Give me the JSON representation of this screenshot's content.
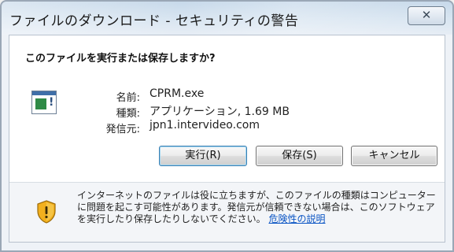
{
  "window": {
    "title": "ファイルのダウンロード - セキュリティの警告",
    "close_glyph": "✕"
  },
  "dialog": {
    "question": "このファイルを実行または保存しますか?",
    "file_icon": "executable-file-icon",
    "fields": {
      "name_label": "名前:",
      "name_value": "CPRM.exe",
      "type_label": "種類:",
      "type_value": "アプリケーション, 1.69 MB",
      "from_label": "発信元:",
      "from_value": "jpn1.intervideo.com"
    },
    "buttons": {
      "run": "実行(R)",
      "save": "保存(S)",
      "cancel": "キャンセル"
    },
    "warning": {
      "icon": "shield-warning-icon",
      "text": "インターネットのファイルは役に立ちますが、このファイルの種類はコンピューターに問題を起こす可能性があります。発信元が信頼できない場合は、このソフトウェアを実行したり保存したりしないでください。",
      "link": "危険性の説明"
    }
  }
}
